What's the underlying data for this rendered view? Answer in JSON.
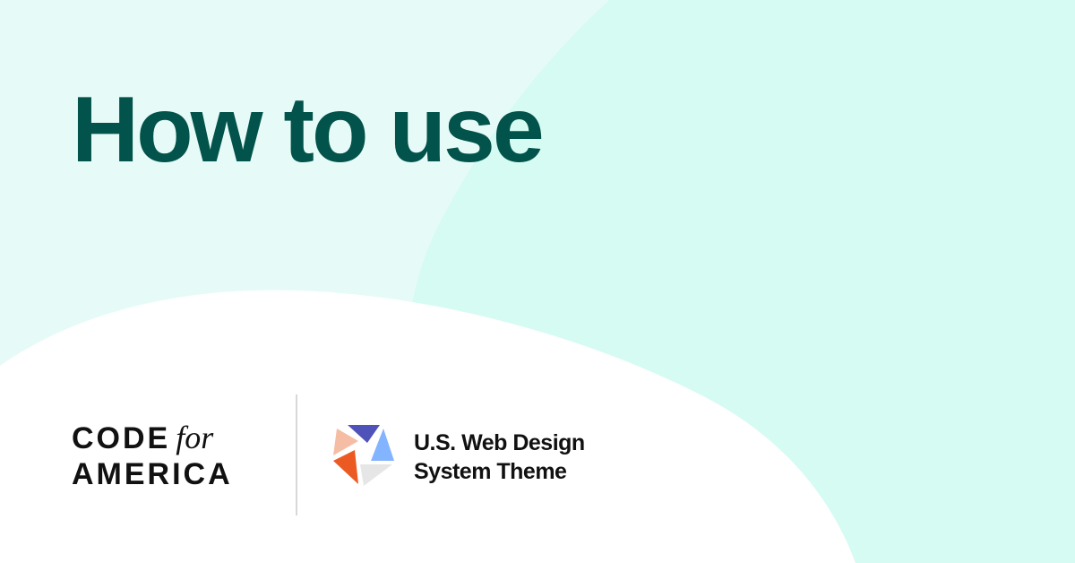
{
  "headline": "How to use",
  "brand": {
    "line1_caps": "CODE",
    "line1_script": "for",
    "line2_caps": "AMERICA"
  },
  "product": {
    "line1": "U.S. Web Design",
    "line2": "System Theme"
  },
  "colors": {
    "headline": "#02534b",
    "text": "#111111",
    "mint_light": "#e6fbf7",
    "mint": "#d6fbf3",
    "white": "#ffffff",
    "divider": "#d8d8d8",
    "mark_indigo": "#4f52b8",
    "mark_blue": "#83b4ff",
    "mark_peach": "#f5bda3",
    "mark_orange": "#ec5a23",
    "mark_gray": "#e6e6e6"
  },
  "icons": {
    "uswds_mark": "uswds-logo-icon"
  }
}
